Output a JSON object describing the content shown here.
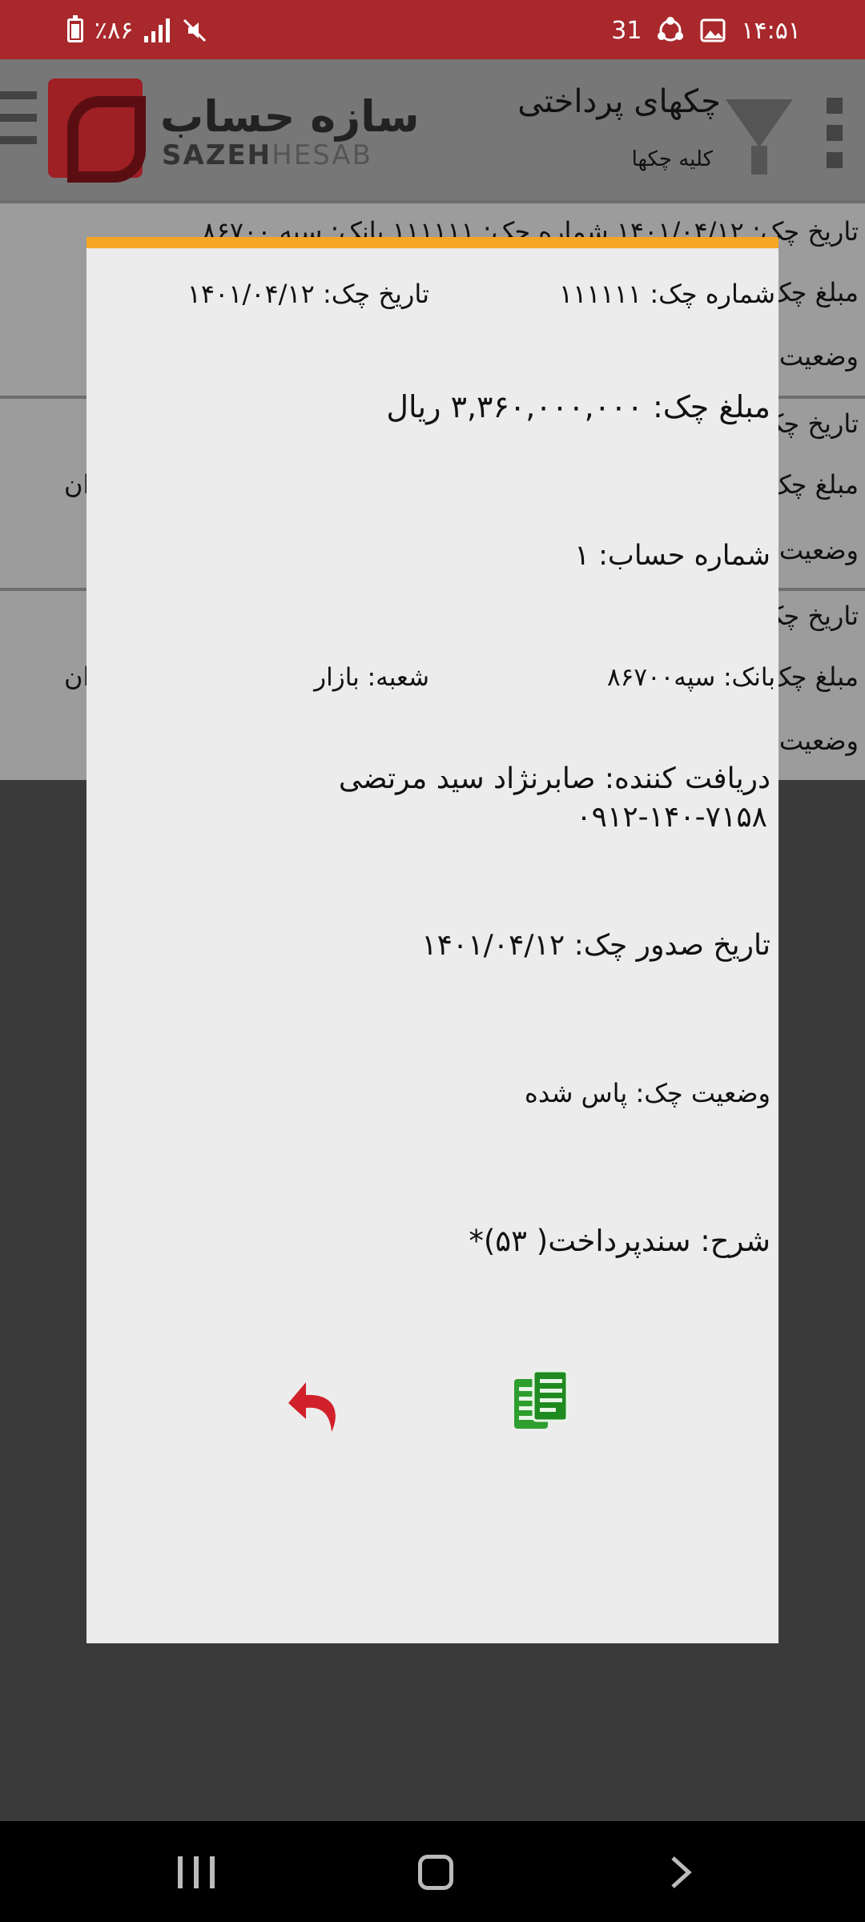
{
  "status_bar": {
    "battery": "٪۸۶",
    "date_num": "31",
    "time": "۱۴:۵۱"
  },
  "app": {
    "logo_text": "سازه حساب",
    "logo_sub_a": "SAZEH",
    "logo_sub_b": "HESAB",
    "title": "چکهای پرداختی",
    "subtitle": "کلیه چکها",
    "rows": [
      {
        "line1": "تاریخ چک: ۱۴۰۱/۰۴/۱۲  شماره چک: ۱۱۱۱۱۱  بانک: سپه ۸۶۷۰۰",
        "line2": "مبلغ چک",
        "line3": "وضعیت"
      },
      {
        "line1": "تاریخ چک",
        "line2": "مبلغ چک",
        "line3": "وضعیت",
        "left": "ان"
      },
      {
        "line1": "تاریخ چک",
        "line2": "مبلغ چک",
        "line3": "وضعیت",
        "left": "ان"
      }
    ]
  },
  "dialog": {
    "check_number": "شماره چک:  ۱۱۱۱۱۱",
    "check_date": "تاریخ چک:  ۱۴۰۱/۰۴/۱۲",
    "amount": "مبلغ چک:  ۳,۳۶۰,۰۰۰,۰۰۰  ریال",
    "account": "شماره حساب:  ۱",
    "bank": "بانک: سپه۸۶۷۰۰",
    "branch": "شعبه: بازار",
    "receiver": "دریافت کننده: صابرنژاد سید مرتضی",
    "receiver_phone": "۰۹۱۲-۱۴۰-۷۱۵۸",
    "issue_date": "تاریخ صدور چک:  ۱۴۰۱/۰۴/۱۲",
    "status": "وضعیت چک: پاس شده",
    "description": "شرح: سندپرداخت( ۵۳)*",
    "accent_color": "#f5a623",
    "copy_icon": "copy-document-icon",
    "back_icon": "reply-arrow-icon"
  }
}
